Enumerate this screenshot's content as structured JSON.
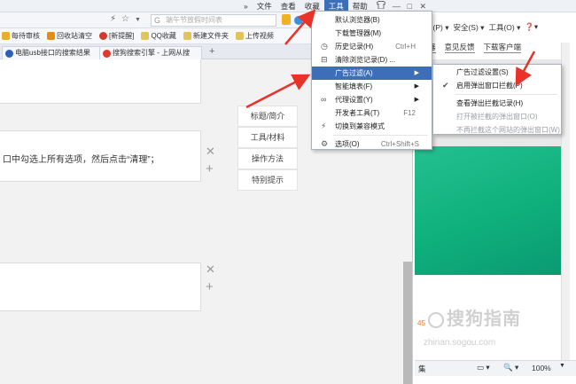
{
  "menubar": {
    "chevron": "»",
    "items": [
      "文件",
      "查看",
      "收藏",
      "工具",
      "帮助"
    ],
    "active_index": 3,
    "shirt_icon": "shirt-icon",
    "win_min": "—",
    "win_max": "□",
    "win_close": "✕"
  },
  "address": {
    "search_placeholder": "端午节放假时间表",
    "search_engine_glyph": "G"
  },
  "bookmarks": [
    {
      "label": "每待审核",
      "color": "#e8b02a"
    },
    {
      "label": "回收站清空",
      "color": "#e78a1e"
    },
    {
      "label": "[新提醒]",
      "color": "#d13a2e"
    },
    {
      "label": "QQ收藏",
      "color": "#e1c55a"
    },
    {
      "label": "新建文件夹",
      "color": "#e1c55a"
    },
    {
      "label": "上传视频",
      "color": "#e1c55a"
    }
  ],
  "tabs": [
    {
      "label": "电脑usb接口的搜索结果",
      "color": "#2b5fb8"
    },
    {
      "label": "搜狗搜索引擎 - 上网从搜",
      "color": "#e0392b"
    }
  ],
  "content": {
    "instruction_text": "口中勾选上所有选项，然后点击“清理”；",
    "side_nav": [
      "标题/简介",
      "工具/材料",
      "操作方法",
      "特别提示"
    ],
    "close_glyph": "✕",
    "add_glyph": "+"
  },
  "right_window": {
    "menu": [
      "面(P) ▾",
      "安全(S) ▾",
      "工具(O) ▾",
      "❓▾"
    ],
    "links": [
      "器",
      "意见反馈",
      "下载客户端"
    ],
    "watermark": "搜狗指南",
    "watermark_url": "zhinan.sogou.com",
    "status_zoom": "100%",
    "status_left": "集",
    "orange_num": "45"
  },
  "tools_menu": {
    "items": [
      {
        "label": "默认浏览器(B)",
        "shortcut": "",
        "arrow": false,
        "icon": ""
      },
      {
        "label": "下载管理器(M)",
        "shortcut": "",
        "arrow": false,
        "icon": ""
      },
      {
        "label": "历史记录(H)",
        "shortcut": "Ctrl+H",
        "arrow": false,
        "icon": "clock-icon"
      },
      {
        "label": "清除浏览记录(D) ...",
        "shortcut": "",
        "arrow": false,
        "icon": "eraser-icon"
      },
      {
        "label": "广告过滤(A)",
        "shortcut": "",
        "arrow": true,
        "icon": "",
        "highlight": true
      },
      {
        "label": "智能填表(F)",
        "shortcut": "",
        "arrow": true,
        "icon": ""
      },
      {
        "label": "代理设置(Y)",
        "shortcut": "",
        "arrow": true,
        "icon": "link-icon"
      },
      {
        "label": "开发者工具(T)",
        "shortcut": "F12",
        "arrow": false,
        "icon": ""
      },
      {
        "label": "切换到兼容模式",
        "shortcut": "",
        "arrow": false,
        "icon": "bolt-icon"
      },
      {
        "label": "选项(O)",
        "shortcut": "Ctrl+Shift+S",
        "arrow": false,
        "icon": "gear-icon"
      }
    ]
  },
  "ad_filter_submenu": {
    "items": [
      {
        "label": "广告过滤设置(S)",
        "checked": false,
        "disabled": false
      },
      {
        "label": "启用弹出窗口拦截(P)",
        "checked": true,
        "disabled": false
      },
      {
        "label": "查看弹出拦截记录(H)",
        "checked": false,
        "disabled": false
      },
      {
        "label": "打开被拦截的弹出窗口(O)",
        "checked": false,
        "disabled": true
      },
      {
        "label": "不再拦截这个网站的弹出窗口(W)",
        "checked": false,
        "disabled": true
      }
    ],
    "check_glyph": "✔"
  },
  "colors": {
    "menu_highlight": "#3d6fb8",
    "arrow_red": "#e8322a",
    "banner_green": "#1bb985"
  }
}
